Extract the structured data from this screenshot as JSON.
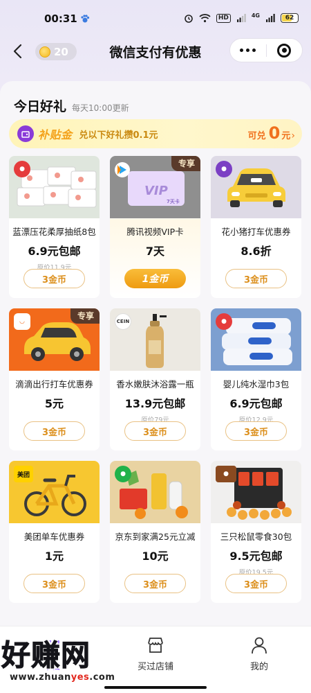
{
  "status_bar": {
    "time": "00:31",
    "network": "4G",
    "hd": "HD",
    "battery": "62"
  },
  "nav": {
    "coins": "20",
    "title": "微信支付有优惠"
  },
  "section": {
    "title": "今日好礼",
    "subtitle": "每天10:00更新"
  },
  "banner": {
    "brand": "补贴金",
    "text": "兑以下好礼攒0.1元",
    "label": "可兑",
    "value": "0",
    "unit": "元"
  },
  "products": [
    {
      "name": "蓝漂压花柔厚抽纸8包",
      "price": "6.9元包邮",
      "original": "原价11.9元",
      "button": "3金币",
      "badge": ""
    },
    {
      "name": "腾讯视频VIP卡",
      "price": "7天",
      "original": "",
      "button": "1金币",
      "badge": "专享",
      "card_text": "VIP",
      "card_sub": "7天卡"
    },
    {
      "name": "花小猪打车优惠券",
      "price": "8.6折",
      "original": "",
      "button": "3金币",
      "badge": ""
    },
    {
      "name": "滴滴出行打车优惠券",
      "price": "5元",
      "original": "",
      "button": "3金币",
      "badge": "专享"
    },
    {
      "name": "香水嫩肤沐浴露一瓶",
      "price": "13.9元包邮",
      "original": "原价79元",
      "button": "3金币",
      "badge": "",
      "brand": "CEIN"
    },
    {
      "name": "婴儿纯水湿巾3包",
      "price": "6.9元包邮",
      "original": "原价12.9元",
      "button": "3金币",
      "badge": ""
    },
    {
      "name": "美团单车优惠券",
      "price": "1元",
      "original": "",
      "button": "3金币",
      "badge": "",
      "brand": "美团"
    },
    {
      "name": "京东到家满25元立减",
      "price": "10元",
      "original": "",
      "button": "3金币",
      "badge": ""
    },
    {
      "name": "三只松鼠零食30包",
      "price": "9.5元包邮",
      "original": "原价19.5元",
      "button": "3金币",
      "badge": ""
    }
  ],
  "tabbar": {
    "tab_home": "今日",
    "tab_store": "买过店铺",
    "tab_mine": "我的"
  },
  "watermark": {
    "cn": "好赚网",
    "en_prefix": "www.zhuan",
    "en_accent": "yes",
    "en_suffix": ".com"
  },
  "colors": {
    "accent": "#f0701d",
    "gold_button": "#ee9b11",
    "badge_bg": "#5a3a2a",
    "banner_bg": "#fff4b8"
  }
}
